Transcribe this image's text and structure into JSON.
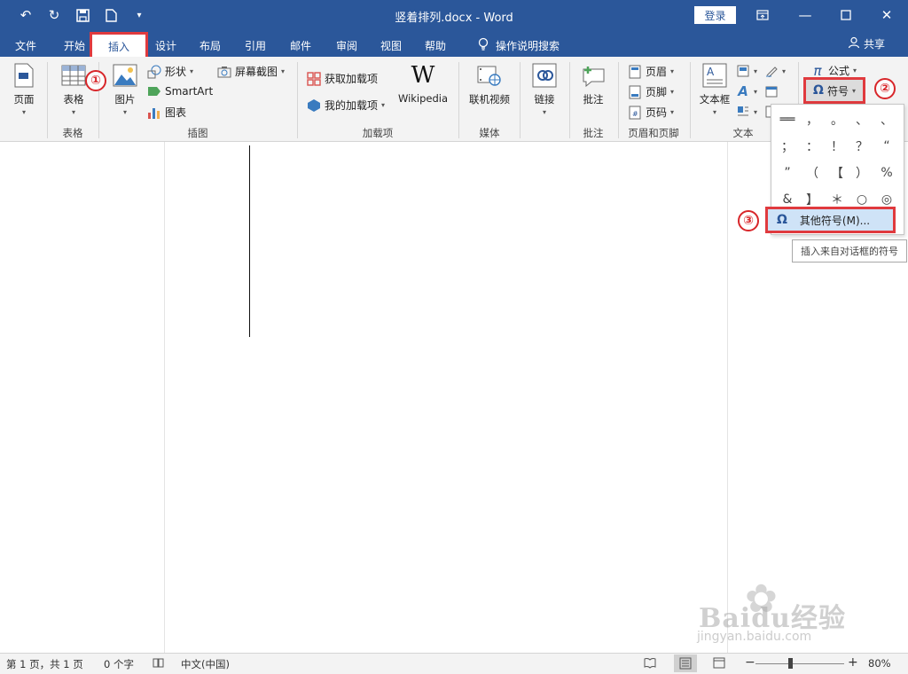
{
  "window": {
    "title": "竖着排列.docx - Word",
    "login_label": "登录",
    "colors": {
      "titlebar": "#2b579a",
      "highlight": "#e03a3e"
    }
  },
  "qat": {
    "icons": [
      "undo-icon",
      "redo-icon",
      "save-icon",
      "new-doc-icon",
      "customize-icon"
    ]
  },
  "tabs": [
    {
      "label": "文件"
    },
    {
      "label": "开始"
    },
    {
      "label": "插入",
      "active": true
    },
    {
      "label": "设计"
    },
    {
      "label": "布局"
    },
    {
      "label": "引用"
    },
    {
      "label": "邮件"
    },
    {
      "label": "审阅"
    },
    {
      "label": "视图"
    },
    {
      "label": "帮助"
    },
    {
      "label": "操作说明搜索"
    }
  ],
  "share_label": "共享",
  "ribbon": {
    "pages": {
      "button": "页面"
    },
    "tables": {
      "button": "表格",
      "group": "表格"
    },
    "illustrations": {
      "picture": "图片",
      "shapes": "形状",
      "smartart": "SmartArt",
      "chart": "图表",
      "screenshot": "屏幕截图",
      "group": "插图"
    },
    "addins": {
      "get": "获取加载项",
      "mine": "我的加载项",
      "wikipedia": "Wikipedia",
      "group": "加载项"
    },
    "media": {
      "video": "联机视频",
      "group": "媒体"
    },
    "links": {
      "link": "链接"
    },
    "comments": {
      "comment": "批注",
      "group": "批注"
    },
    "header_footer": {
      "header": "页眉",
      "footer": "页脚",
      "page_number": "页码",
      "group": "页眉和页脚"
    },
    "text": {
      "textbox": "文本框",
      "group": "文本"
    },
    "symbols": {
      "equation": "公式",
      "symbol": "符号"
    }
  },
  "symbol_dropdown": {
    "symbols": [
      "══",
      "，",
      "。",
      "、",
      "、",
      "；",
      "：",
      "！",
      "？",
      "“",
      "”",
      "（",
      "【",
      "）",
      "%",
      "&",
      "】",
      "＊",
      "○",
      "◎"
    ],
    "more_label": "其他符号(M)...",
    "tooltip": "插入来自对话框的符号"
  },
  "steps": [
    "①",
    "②",
    "③"
  ],
  "status": {
    "page": "第 1 页，共 1 页",
    "words": "0 个字",
    "language": "中文(中国)",
    "zoom": "80%",
    "zoom_percent": 80
  },
  "watermark": {
    "brand": "Baidu经验",
    "sub": "jingyan.baidu.com"
  }
}
